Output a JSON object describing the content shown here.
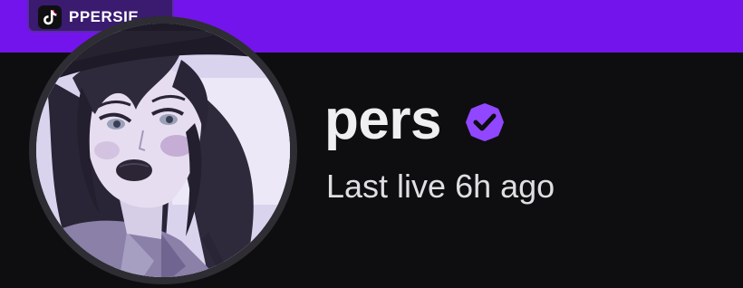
{
  "watermark": {
    "platform_icon": "tiktok-icon",
    "handle": "PPERSIE"
  },
  "profile": {
    "channel_name": "pers",
    "verified_icon": "verified-badge-icon",
    "status_text": "Last live 6h ago",
    "avatar_icon": "avatar-illustration"
  },
  "colors": {
    "banner": "#7414ec",
    "background": "#0e0e10",
    "verified": "#9147ff",
    "text_primary": "#efeff1",
    "text_secondary": "#dedee3"
  }
}
